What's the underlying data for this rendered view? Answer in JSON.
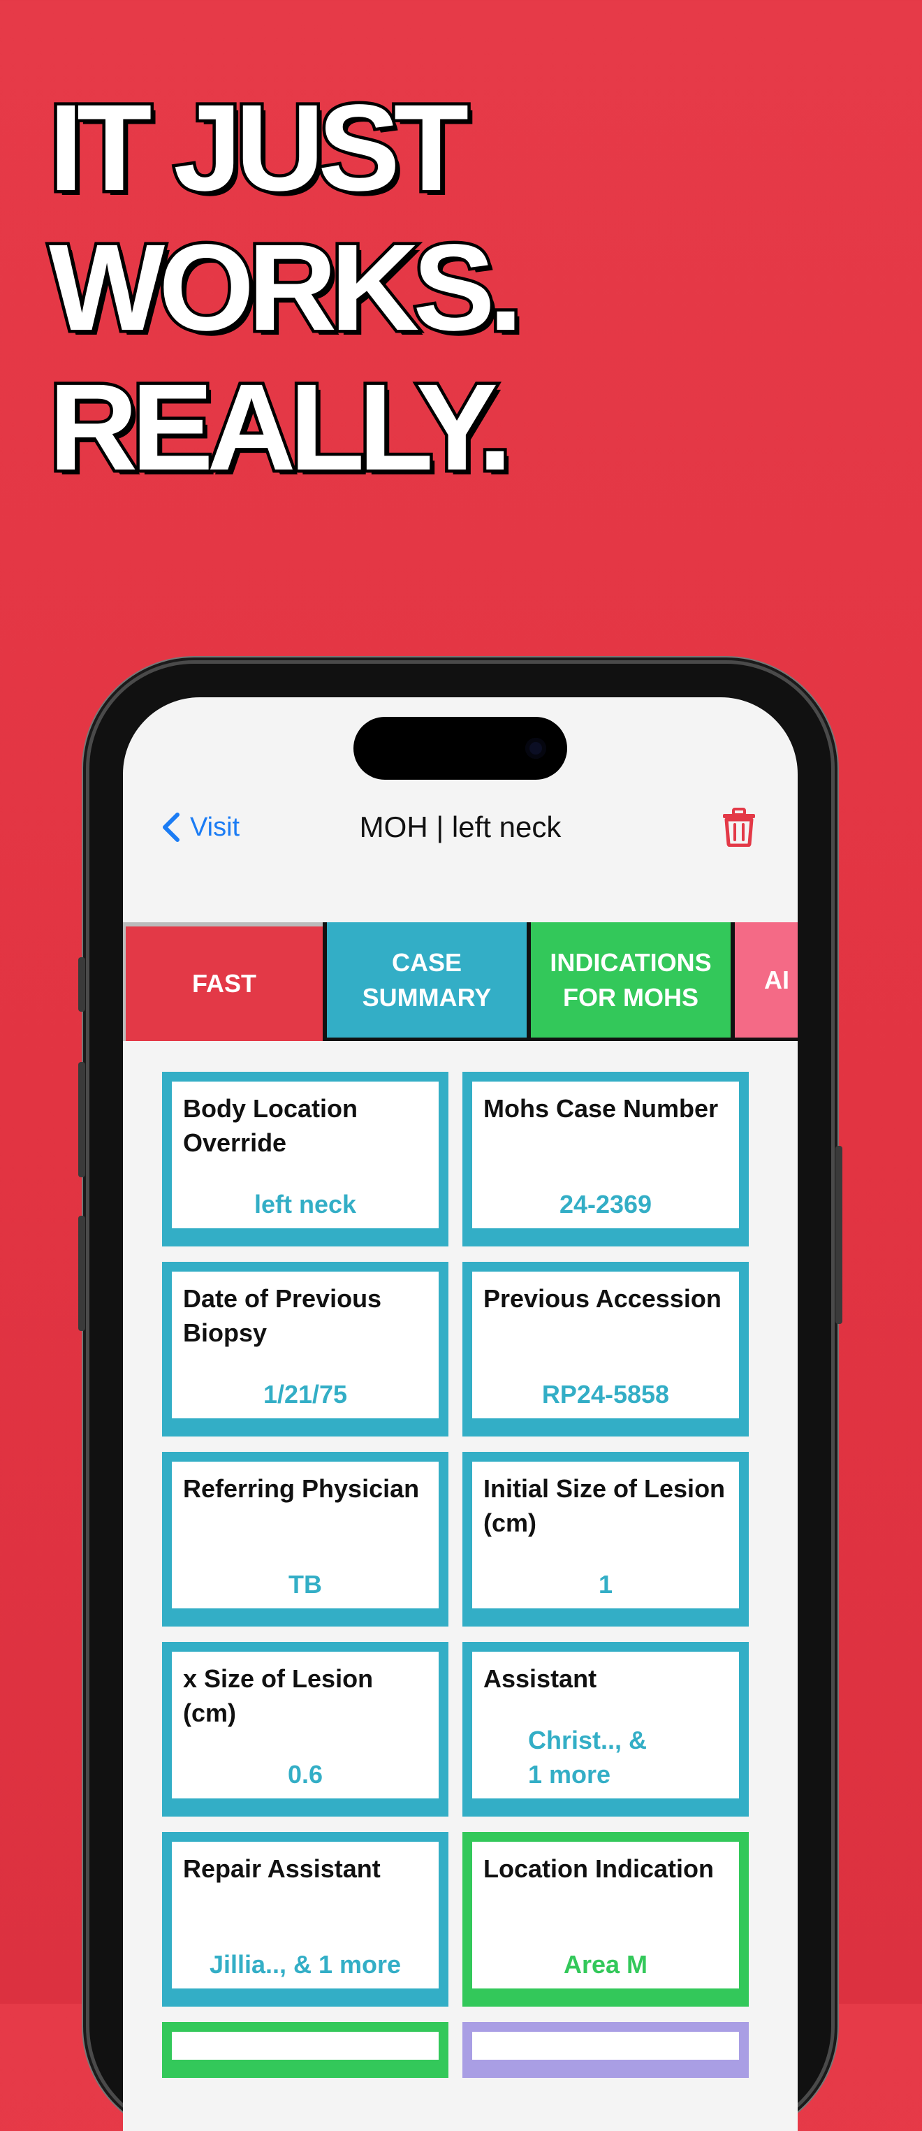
{
  "headline": {
    "line1": "IT JUST",
    "line2": "WORKS.",
    "line3": "REALLY."
  },
  "colors": {
    "background": "#e53746",
    "link": "#1b7cf4",
    "tab_fast": "#e33947",
    "tab_case_summary": "#33aec6",
    "tab_indications": "#33c85a",
    "tab_peek": "#f46a86",
    "card_blue": "#33aec6",
    "card_green": "#33c85a",
    "card_purple": "#a99ee4",
    "trash": "#e33947"
  },
  "nav": {
    "back_label": "Visit",
    "title": "MOH | left neck",
    "trash_icon": "trash-icon"
  },
  "tabs": [
    {
      "label": "FAST",
      "color": "#e33947"
    },
    {
      "label": "CASE\nSUMMARY",
      "color": "#33aec6"
    },
    {
      "label": "INDICATIONS\nFOR MOHS",
      "color": "#33c85a"
    },
    {
      "label": "AI",
      "color": "#f46a86"
    }
  ],
  "cards": [
    {
      "label": "Body Location Override",
      "value": "left neck",
      "color": "#33aec6"
    },
    {
      "label": "Mohs Case Number",
      "value": "24-2369",
      "color": "#33aec6"
    },
    {
      "label": "Date of Previous Biopsy",
      "value": "1/21/75",
      "color": "#33aec6"
    },
    {
      "label": "Previous Accession",
      "value": "RP24-5858",
      "color": "#33aec6"
    },
    {
      "label": "Referring Physician",
      "value": "TB",
      "color": "#33aec6"
    },
    {
      "label": "Initial Size of Lesion (cm)",
      "value": "1",
      "color": "#33aec6"
    },
    {
      "label": "x Size of Lesion (cm)",
      "value": "0.6",
      "color": "#33aec6"
    },
    {
      "label": "Assistant",
      "value": "Christ.., &\n1 more",
      "color": "#33aec6"
    },
    {
      "label": "Repair Assistant",
      "value": "Jillia.., & 1 more",
      "color": "#33aec6"
    },
    {
      "label": "Location Indication",
      "value": "Area M",
      "color": "#33c85a"
    }
  ]
}
